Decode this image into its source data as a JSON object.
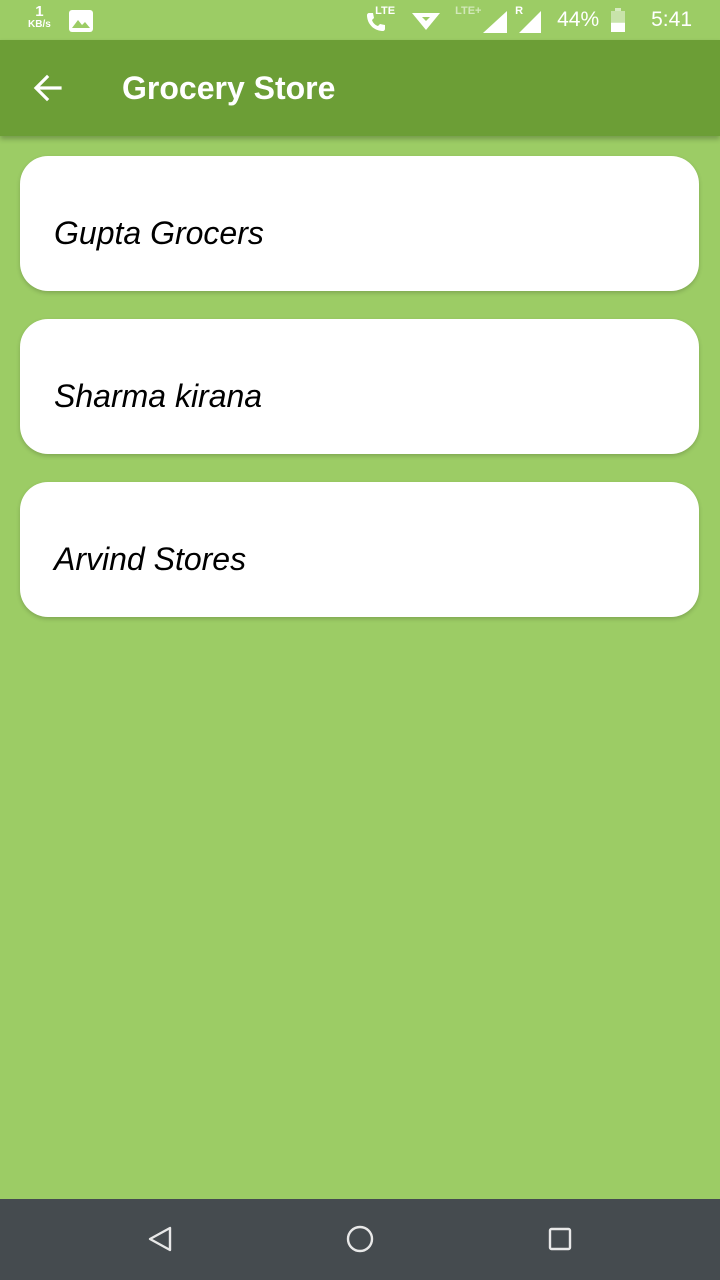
{
  "status_bar": {
    "net_speed_value": "1",
    "net_speed_unit": "KB/s",
    "lte_label": "LTE",
    "lte_plus_label": "LTE+",
    "roaming_label": "R",
    "battery_percent": "44%",
    "time": "5:41",
    "battery_level": 0.44,
    "icons": [
      "image-icon",
      "volte-call-icon",
      "data-arrows-icon",
      "signal-icon",
      "signal-roaming-icon",
      "battery-icon"
    ]
  },
  "app_bar": {
    "title": "Grocery Store",
    "back_icon": "arrow-back-icon"
  },
  "stores": [
    {
      "name": "Gupta Grocers"
    },
    {
      "name": "Sharma kirana"
    },
    {
      "name": "Arvind Stores"
    }
  ],
  "nav_bar": {
    "icons": [
      "back-triangle-icon",
      "home-circle-icon",
      "recents-square-icon"
    ]
  },
  "colors": {
    "background": "#9ccc65",
    "app_bar": "#6c9e36",
    "nav_bar": "#454b4f",
    "card": "#ffffff"
  }
}
